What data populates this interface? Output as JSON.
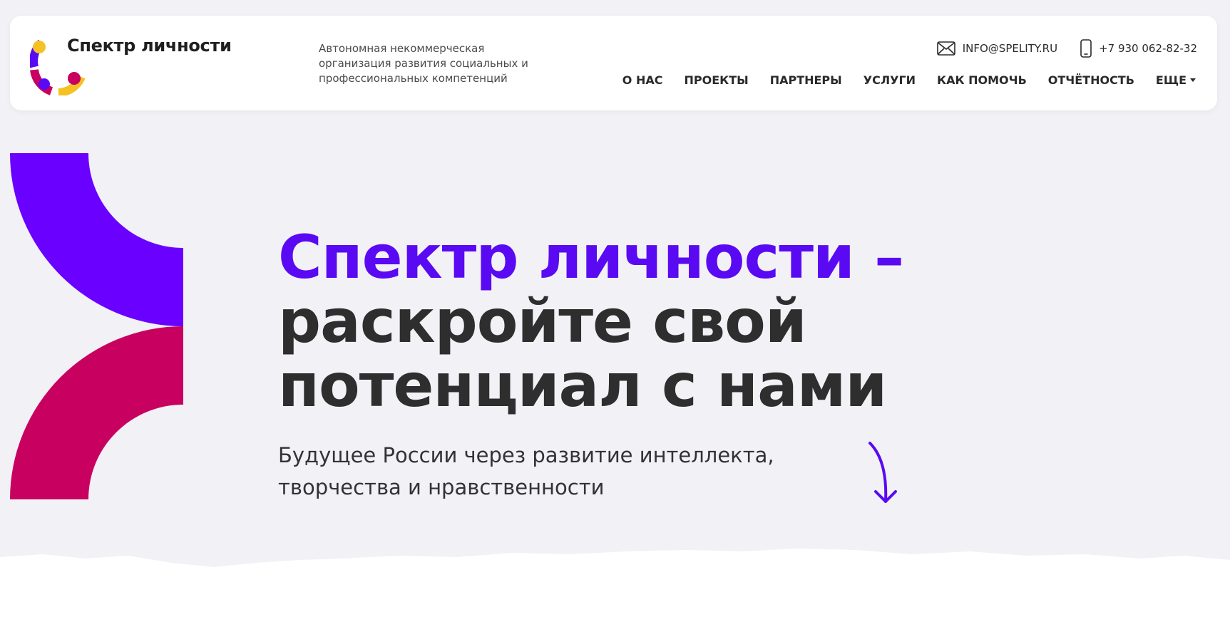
{
  "brand": {
    "name": "Спектр личности",
    "tagline": "Автономная некоммерческая организация развития социальных и профессиональных компетенций",
    "logo_icon": "logo-ring-icon",
    "colors": {
      "purple": "#5a0af2",
      "crimson": "#c8005f",
      "yellow": "#f5c224"
    }
  },
  "contacts": {
    "email": "INFO@SPELITY.RU",
    "email_icon": "mail-icon",
    "phone": "+7 930 062-82-32",
    "phone_icon": "phone-icon"
  },
  "nav": {
    "items": [
      {
        "label": "О НАС"
      },
      {
        "label": "ПРОЕКТЫ"
      },
      {
        "label": "ПАРТНЕРЫ"
      },
      {
        "label": "УСЛУГИ"
      },
      {
        "label": "КАК ПОМОЧЬ"
      },
      {
        "label": "ОТЧЁТНОСТЬ"
      },
      {
        "label": "ЕЩЕ"
      }
    ],
    "more_icon": "caret-down-icon"
  },
  "hero": {
    "title_accent": "Спектр личности –",
    "title_rest": "раскройте свой потенциал с нами",
    "subtitle": "Будущее России через развитие интеллекта, творчества и нравственности",
    "arrow_icon": "arrow-down-icon"
  }
}
